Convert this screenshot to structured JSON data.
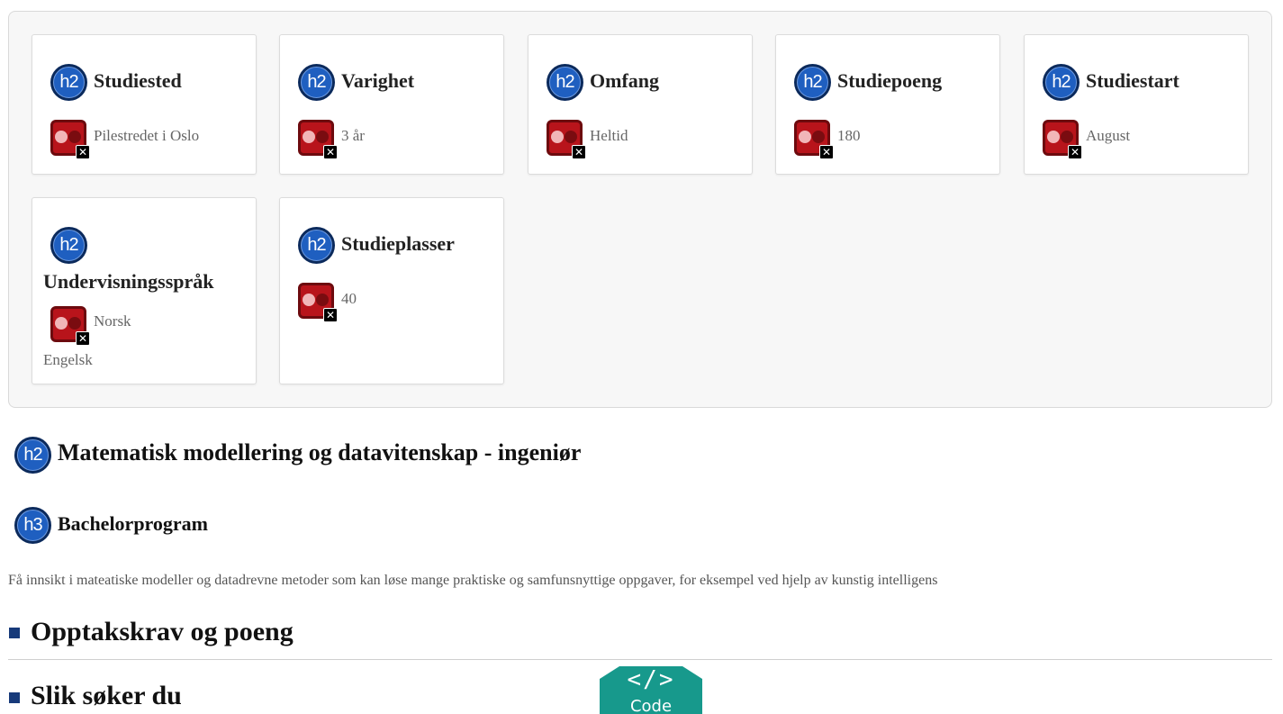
{
  "facts": {
    "cards": [
      {
        "title": "Studiested",
        "value": "Pilestredet i Oslo"
      },
      {
        "title": "Varighet",
        "value": "3 år"
      },
      {
        "title": "Omfang",
        "value": "Heltid"
      },
      {
        "title": "Studiepoeng",
        "value": "180"
      },
      {
        "title": "Studiestart",
        "value": "August"
      },
      {
        "title": "Undervisningsspråk",
        "value": "Norsk",
        "value2": "Engelsk"
      },
      {
        "title": "Studieplasser",
        "value": "40"
      }
    ],
    "heading_tag": "h2",
    "image_icon": "broken-image-icon"
  },
  "program": {
    "title": "Matematisk modellering og datavitenskap - ingeniør",
    "title_tag": "h2",
    "subtitle": "Bachelorprogram",
    "subtitle_tag": "h3",
    "intro": "Få innsikt i mateatiske modeller og datadrevne metoder som kan løse mange praktiske og samfunsnyttige oppgaver, for eksempel ved hjelp av kunstig intelligens"
  },
  "accordion": [
    {
      "title": "Opptakskrav og poeng"
    },
    {
      "title": "Slik søker du"
    }
  ],
  "code_badge": {
    "symbol": "</>",
    "label": "Code"
  },
  "colors": {
    "heading_icon": "#1f5fc0",
    "image_icon": "#b8141b",
    "accordion_marker": "#173a7a",
    "code_badge": "#17998c"
  }
}
